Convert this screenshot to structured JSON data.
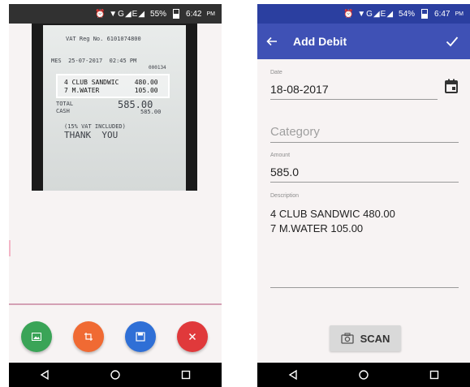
{
  "left_screen": {
    "status": {
      "percent": "55%",
      "time": "6:42",
      "ampm": "PM"
    },
    "receipt_lines": [
      "VAT Reg No. 6101074800",
      "MES  25-07-2017  02:45 PM",
      "000134",
      "TOTAL",
      "CASH",
      "585.00",
      "585.00",
      "(15% VAT INCLUDED)",
      "THANK  YOU"
    ],
    "scan_box_lines": [
      "4 CLUB SANDWIC    480.00",
      "7 M.WATER         105.00"
    ],
    "fab_icons": [
      "gallery-icon",
      "crop-icon",
      "save-icon",
      "close-icon"
    ]
  },
  "right_screen": {
    "status": {
      "percent": "54%",
      "time": "6:47",
      "ampm": "PM"
    },
    "title": "Add Debit",
    "date_label": "Date",
    "date_value": "18-08-2017",
    "category_placeholder": "Category",
    "amount_label": "Amount",
    "amount_value": "585.0",
    "description_label": "Description",
    "description_lines": [
      "4 CLUB SANDWIC 480.00",
      "7 M.WATER 105.00"
    ],
    "scan_label": "SCAN"
  },
  "colors": {
    "primary": "#3f51b5",
    "status_dark": "#2b3fa0",
    "fab_green": "#3aa457",
    "fab_orange": "#f06a33",
    "fab_blue": "#2f6fd6",
    "fab_red": "#e0393b"
  }
}
